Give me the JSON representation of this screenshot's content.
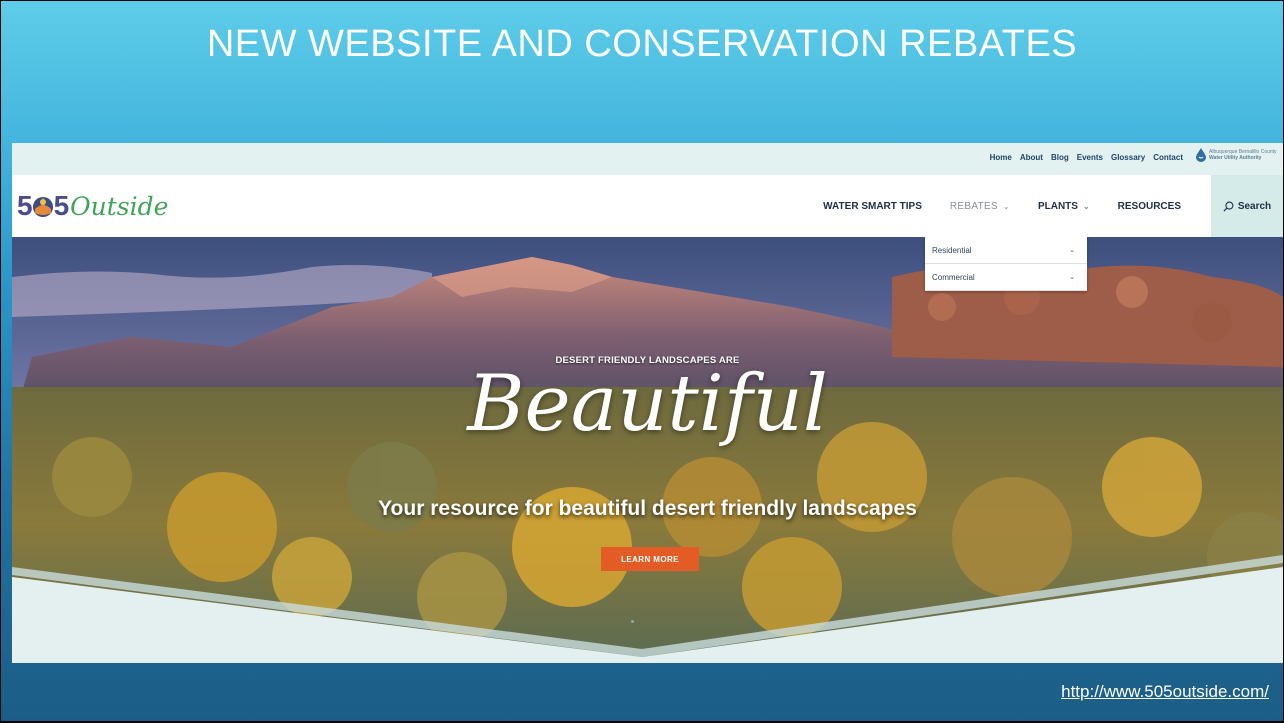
{
  "slide": {
    "title": "NEW WEBSITE AND CONSERVATION REBATES",
    "url": "http://www.505outside.com/"
  },
  "site": {
    "utility_links": [
      "Home",
      "About",
      "Blog",
      "Events",
      "Glossary",
      "Contact"
    ],
    "authority_lines": [
      "Albuquerque Bernalillo County",
      "Water Utility Authority"
    ],
    "logo": {
      "prefix": "5",
      "suffix": "5",
      "word": "Outside"
    },
    "menu": [
      {
        "label": "WATER SMART TIPS",
        "chevron": false,
        "dim": false
      },
      {
        "label": "REBATES",
        "chevron": true,
        "dim": true
      },
      {
        "label": "PLANTS",
        "chevron": true,
        "dim": false
      },
      {
        "label": "RESOURCES",
        "chevron": false,
        "dim": false
      }
    ],
    "search_label": "Search",
    "rebates_dropdown": [
      "Residential",
      "Commercial"
    ],
    "hero": {
      "tagline": "DESERT FRIENDLY LANDSCAPES ARE",
      "headline": "Beautiful",
      "subheadline": "Your resource for beautiful desert friendly landscapes",
      "cta_label": "LEARN MORE"
    }
  },
  "colors": {
    "accent_orange": "#e35b25",
    "nav_text": "#1f2f44",
    "logo_purple": "#4a4c8f",
    "logo_green": "#3fa457"
  }
}
